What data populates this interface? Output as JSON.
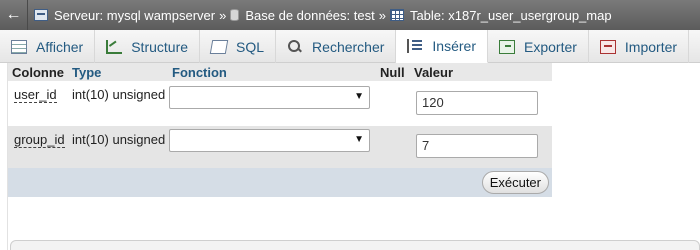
{
  "breadcrumb": {
    "server": "Serveur: mysql wampserver",
    "separator": "»",
    "database": "Base de données: test",
    "table": "Table: x187r_user_usergroup_map"
  },
  "tabs": [
    {
      "label": "Afficher",
      "icon": "browse-icon"
    },
    {
      "label": "Structure",
      "icon": "structure-icon"
    },
    {
      "label": "SQL",
      "icon": "sql-icon"
    },
    {
      "label": "Rechercher",
      "icon": "search-icon"
    },
    {
      "label": "Insérer",
      "icon": "insert-icon",
      "active": true
    },
    {
      "label": "Exporter",
      "icon": "export-icon"
    },
    {
      "label": "Importer",
      "icon": "import-icon"
    }
  ],
  "insert_form": {
    "headers": {
      "colonne": "Colonne",
      "type": "Type",
      "fonction": "Fonction",
      "null": "Null",
      "valeur": "Valeur"
    },
    "rows": [
      {
        "column": "user_id",
        "type": "int(10) unsigned",
        "function": "",
        "value": "120"
      },
      {
        "column": "group_id",
        "type": "int(10) unsigned",
        "function": "",
        "value": "7"
      }
    ],
    "execute_label": "Exécuter"
  }
}
